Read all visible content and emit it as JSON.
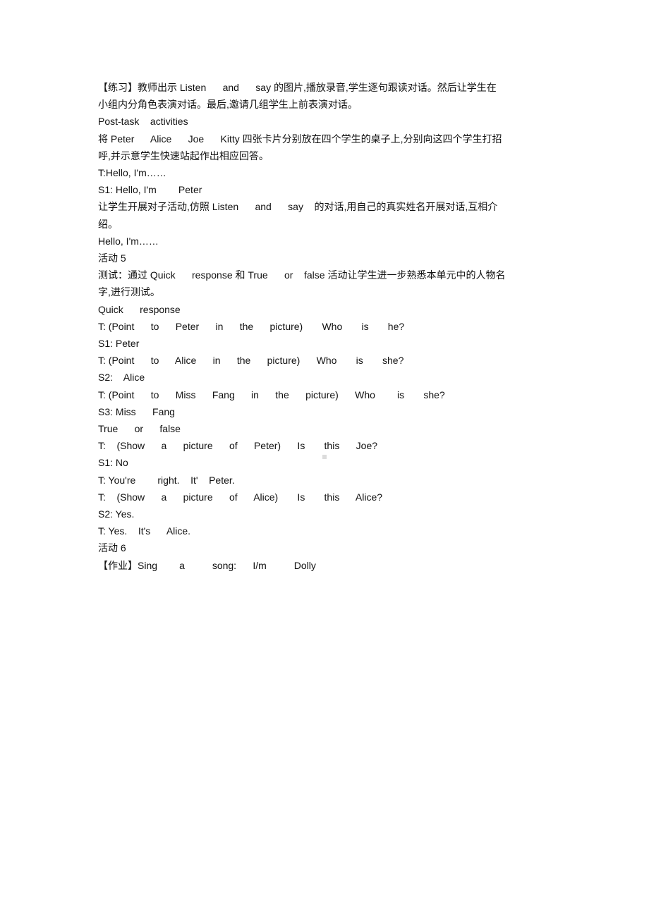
{
  "document": {
    "lines": [
      "【练习】教师出示 Listen      and      say 的图片,播放录音,学生逐句跟读对话。然后让学生在",
      "小组内分角色表演对话。最后,邀请几组学生上前表演对话。",
      "Post-task    activities",
      "将 Peter      Alice      Joe      Kitty 四张卡片分别放在四个学生的桌子上,分别向这四个学生打招",
      "呼,并示意学生快速站起作出相应回答。",
      "T:Hello, I'm……",
      "S1: Hello, I'm        Peter",
      "让学生开展对子活动,仿照 Listen      and      say    的对话,用自己的真实姓名开展对话,互相介",
      "绍。",
      "Hello, I'm……",
      "活动 5",
      "测试：通过 Quick      response 和 True      or    false 活动让学生进一步熟悉本单元中的人物名",
      "字,进行测试。",
      "Quick      response",
      "T: (Point      to      Peter      in      the      picture)       Who       is       he?",
      "S1: Peter",
      "T: (Point      to      Alice      in      the      picture)      Who       is       she?",
      "S2:    Alice",
      "T: (Point      to      Miss      Fang      in      the      picture)      Who        is       she?",
      "S3: Miss      Fang",
      "True      or      false",
      "T:    (Show      a      picture      of      Peter)      Is       this      Joe?",
      "S1: No",
      "T: You're        right.    It'    Peter.",
      "T:    (Show      a      picture      of      Alice)       Is       this      Alice?",
      "S2: Yes.",
      "T: Yes.    It's      Alice.",
      "活动 6",
      "【作业】Sing        a          song:      I/m          Dolly"
    ]
  }
}
